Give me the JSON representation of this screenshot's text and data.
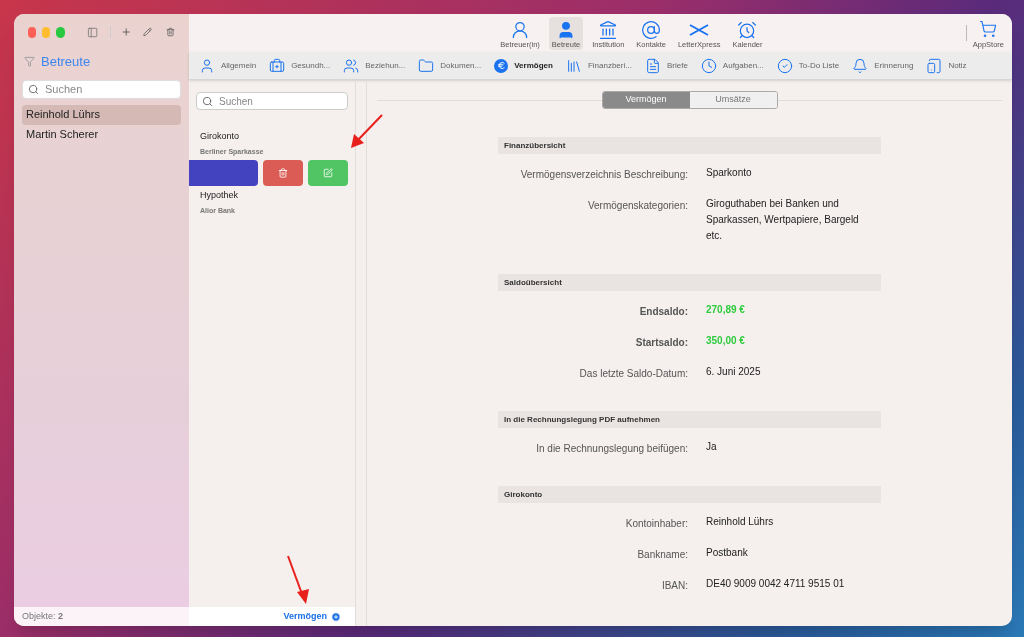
{
  "sidebar": {
    "title": "Betreute",
    "search": {
      "placeholder": "Suchen"
    },
    "items": [
      {
        "label": "Reinhold Lührs",
        "selected": true
      },
      {
        "label": "Martin Scherer",
        "selected": false
      }
    ],
    "footer": "Objekte: **2**"
  },
  "toolbar": {
    "items": [
      {
        "label": "Betreuer(in)",
        "kind": "caregiver",
        "selected": false
      },
      {
        "label": "Betreute",
        "kind": "person",
        "selected": true
      },
      {
        "label": "Institution",
        "kind": "institution",
        "selected": false
      },
      {
        "label": "Kontakte",
        "kind": "contacts",
        "selected": false
      },
      {
        "label": "LetterXpress",
        "kind": "letter",
        "selected": false
      },
      {
        "label": "Kalender",
        "kind": "calendar",
        "selected": false
      }
    ],
    "store": {
      "label": "AppStore"
    }
  },
  "tabs": [
    {
      "label": "Allgemein",
      "kind": "user",
      "selected": false
    },
    {
      "label": "Gesundh...",
      "kind": "health",
      "selected": false
    },
    {
      "label": "Beziehun...",
      "kind": "relations",
      "selected": false
    },
    {
      "label": "Dokumen...",
      "kind": "folder",
      "selected": false
    },
    {
      "label": "Vermögen",
      "kind": "euro",
      "selected": true
    },
    {
      "label": "Finanzberi...",
      "kind": "books",
      "selected": false
    },
    {
      "label": "Briefe",
      "kind": "file",
      "selected": false
    },
    {
      "label": "Aufgaben...",
      "kind": "tasks",
      "selected": false
    },
    {
      "label": "To-Do Liste",
      "kind": "todo",
      "selected": false
    },
    {
      "label": "Erinnerung",
      "kind": "bell",
      "selected": false
    },
    {
      "label": "Notiz",
      "kind": "note",
      "selected": false
    }
  ],
  "assets": {
    "search": {
      "placeholder": "Suchen"
    },
    "items": [
      {
        "title": "Girokonto",
        "subtitle": "Berliner Sparkasse",
        "swiped": true
      },
      {
        "title": "Hypothek",
        "subtitle": "Alior Bank",
        "swiped": false
      }
    ],
    "footer": "Vermögen"
  },
  "detail": {
    "segments": [
      {
        "label": "Vermögen",
        "selected": true
      },
      {
        "label": "Umsätze",
        "selected": false
      }
    ],
    "sections": [
      {
        "title": "Finanzübersicht",
        "rows": [
          {
            "label": "Vermögensverzeichnis Beschreibung:",
            "value": "Sparkonto",
            "kind": "plain"
          },
          {
            "label": "Vermögenskategorien:",
            "value": "Giroguthaben bei Banken und Sparkassen, Wertpapiere, Bargeld etc.",
            "kind": "plain"
          }
        ]
      },
      {
        "title": "Saldoübersicht",
        "rows": [
          {
            "label": "Endsaldo:",
            "value": "270,89 €",
            "kind": "amount"
          },
          {
            "label": "Startsaldo:",
            "value": "350,00 €",
            "kind": "amount"
          },
          {
            "label": "Das letzte Saldo-Datum:",
            "value": "6. Juni 2025",
            "kind": "plain"
          }
        ]
      },
      {
        "title": "In die Rechnungslegung PDF aufnehmen",
        "rows": [
          {
            "label": "In die Rechnungslegung beifügen:",
            "value": "Ja",
            "kind": "plain"
          }
        ]
      },
      {
        "title": "Girokonto",
        "rows": [
          {
            "label": "Kontoinhaber:",
            "value": "Reinhold Lührs",
            "kind": "plain"
          },
          {
            "label": "Bankname:",
            "value": "Postbank",
            "kind": "plain"
          },
          {
            "label": "IBAN:",
            "value": "DE40 9009 0042 4711 9515 01",
            "kind": "plain"
          }
        ]
      }
    ]
  }
}
